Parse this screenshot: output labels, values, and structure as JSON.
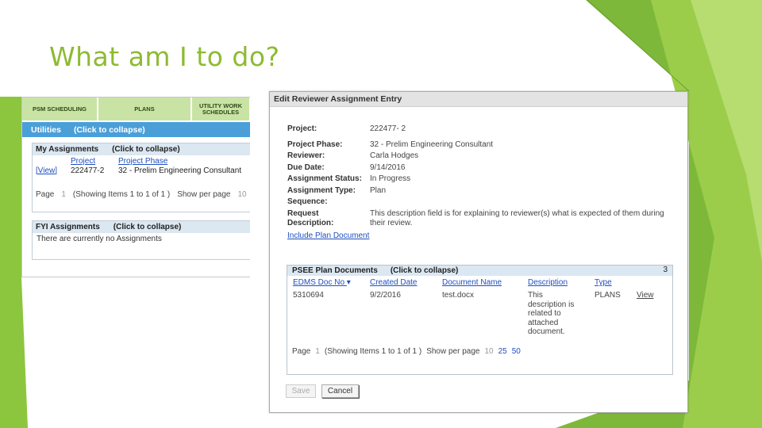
{
  "slide": {
    "title": "What am I to do?"
  },
  "left_panel": {
    "tabs": [
      "PSM SCHEDULING",
      "PLANS",
      "UTILITY WORK SCHEDULES"
    ],
    "utilities_bar": {
      "title": "Utilities",
      "collapse": "(Click to collapse)"
    },
    "my_assignments": {
      "title": "My Assignments",
      "collapse": "(Click to collapse)",
      "columns": [
        "Project",
        "Project Phase"
      ],
      "rows": [
        {
          "action": "[View]",
          "project": "222477-2",
          "phase": "32 - Prelim Engineering Consultant"
        }
      ],
      "pager": {
        "page_label": "Page",
        "page": "1",
        "showing": "(Showing Items 1 to 1 of 1 )",
        "show_per_page": "Show per page",
        "per_page": "10"
      }
    },
    "fyi": {
      "title": "FYI Assignments",
      "collapse": "(Click to collapse)",
      "message": "There are currently no Assignments"
    }
  },
  "dialog": {
    "title": "Edit Reviewer Assignment Entry",
    "fields": [
      {
        "label": "Project:",
        "value": "222477- 2"
      },
      {
        "label": "Project Phase:",
        "value": "32 - Prelim Engineering Consultant"
      },
      {
        "label": "Reviewer:",
        "value": "Carla Hodges"
      },
      {
        "label": "Due Date:",
        "value": "9/14/2016"
      },
      {
        "label": "Assignment Status:",
        "value": "In Progress"
      },
      {
        "label": "Assignment Type:",
        "value": "Plan"
      },
      {
        "label": "Sequence:",
        "value": ""
      },
      {
        "label": "Request",
        "value": "This description field is for explaining to reviewer(s) what is expected of them during"
      },
      {
        "label": "Description:",
        "value": "their review."
      }
    ],
    "include_link": "Include Plan Document",
    "docs": {
      "title": "PSEE Plan Documents",
      "collapse": "(Click to collapse)",
      "corner": "3",
      "columns": [
        "EDMS Doc No",
        "Created Date",
        "Document Name",
        "Description",
        "Type"
      ],
      "row": {
        "doc_no": "5310694",
        "created": "9/2/2016",
        "name": "test.docx",
        "description": "This description is related to attached document.",
        "type": "PLANS",
        "action": "View"
      },
      "pager": {
        "page_label": "Page",
        "page": "1",
        "showing": "(Showing Items 1 to 1 of 1 )",
        "show_per_page": "Show per page",
        "opt1": "10",
        "opt2": "25",
        "opt3": "50"
      }
    },
    "buttons": {
      "save": "Save",
      "cancel": "Cancel"
    }
  },
  "colors": {
    "title_green": "#8dbb32",
    "tab_green": "#c9e3a5",
    "bar_blue": "#4b9fd9",
    "link_blue": "#1f4fbf"
  }
}
